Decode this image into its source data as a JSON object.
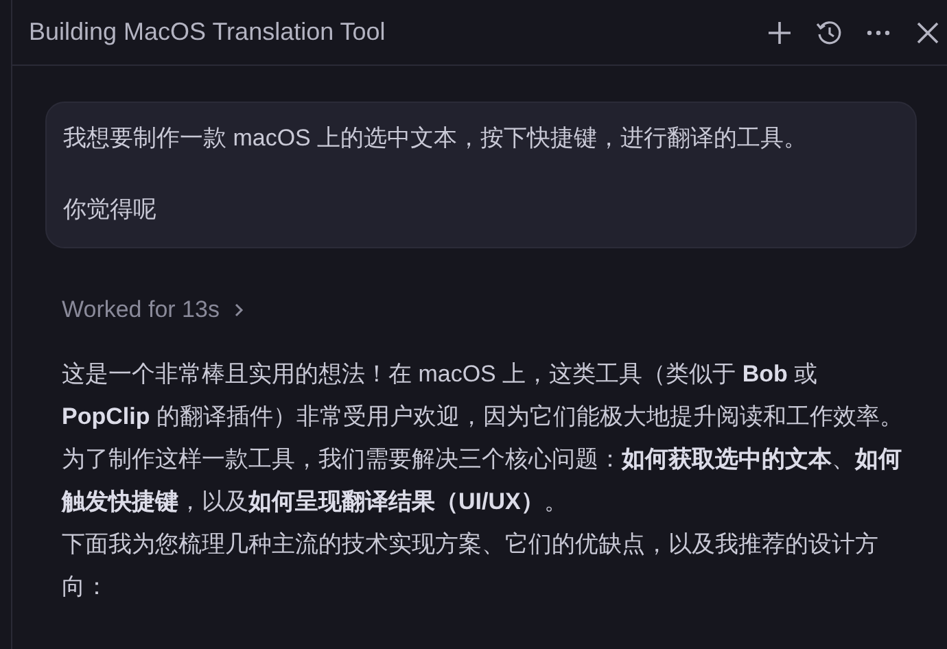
{
  "header": {
    "title": "Building MacOS Translation Tool",
    "actions": [
      {
        "kind": "add"
      },
      {
        "kind": "history"
      },
      {
        "kind": "more"
      },
      {
        "kind": "close"
      }
    ]
  },
  "user_message": {
    "paragraphs": [
      "我想要制作一款 macOS 上的选中文本，按下快捷键，进行翻译的工具。",
      "你觉得呢"
    ]
  },
  "worked": {
    "label": "Worked for 13s",
    "expanded": false
  },
  "reply": {
    "paragraphs": [
      "这是一个非常棒且实用的想法！在 macOS 上，这类工具（类似于 **Bob** 或 **PopClip** 的翻译插件）非常受用户欢迎，因为它们能极大地提升阅读和工作效率。",
      "为了制作这样一款工具，我们需要解决三个核心问题：**如何获取选中的文本**、**如何触发快捷键**，以及**如何呈现翻译结果（UI/UX）**。",
      "下面我为您梳理几种主流的技术实现方案、它们的优缺点，以及我推荐的设计方向："
    ]
  }
}
